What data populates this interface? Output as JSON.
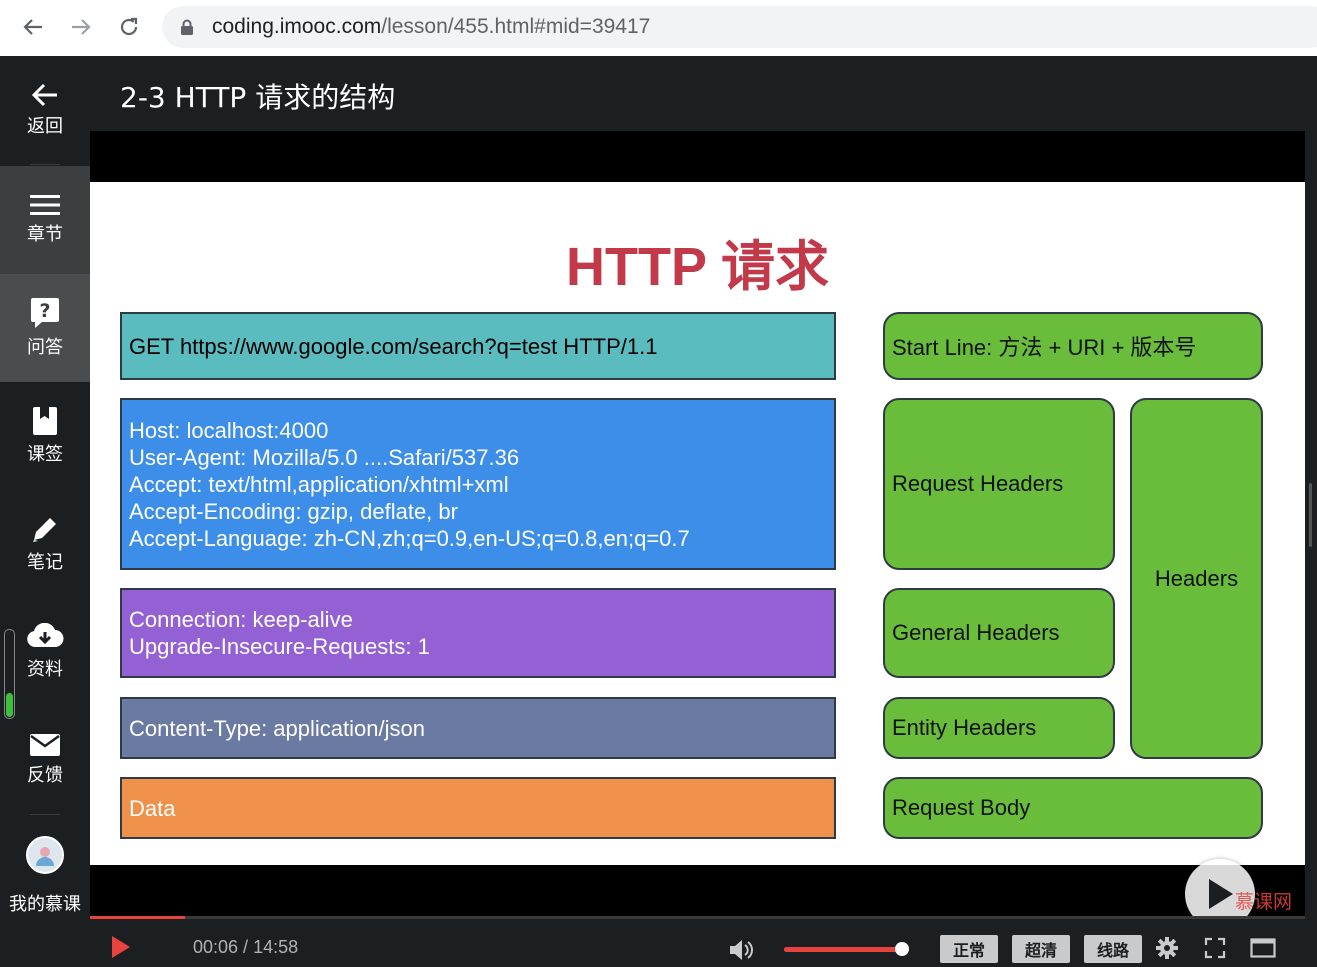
{
  "browser": {
    "url_host": "coding.imooc.com",
    "url_path": "/lesson/455.html#mid=39417"
  },
  "sidebar": {
    "items": [
      {
        "label": "返回",
        "icon": "back-arrow-icon"
      },
      {
        "label": "章节",
        "icon": "menu-icon"
      },
      {
        "label": "问答",
        "icon": "question-icon"
      },
      {
        "label": "课签",
        "icon": "bookmark-icon"
      },
      {
        "label": "笔记",
        "icon": "pencil-icon"
      },
      {
        "label": "资料",
        "icon": "cloud-download-icon"
      },
      {
        "label": "反馈",
        "icon": "mail-icon"
      }
    ],
    "my_mooc_label": "我的慕课",
    "progress_fraction": 0.28
  },
  "lesson": {
    "title": "2-3 HTTP 请求的结构"
  },
  "slide": {
    "title": "HTTP 请求",
    "request_line": "GET https://www.google.com/search?q=test HTTP/1.1",
    "request_headers": [
      "Host: localhost:4000",
      "User-Agent: Mozilla/5.0 ....Safari/537.36",
      "Accept: text/html,application/xhtml+xml",
      "Accept-Encoding: gzip, deflate, br",
      "Accept-Language: zh-CN,zh;q=0.9,en-US;q=0.8,en;q=0.7"
    ],
    "general_headers": [
      "Connection: keep-alive",
      "Upgrade-Insecure-Requests: 1"
    ],
    "entity_header": "Content-Type: application/json",
    "data": "Data",
    "labels": {
      "start_line": "Start Line: 方法 + URI + 版本号",
      "request_headers": "Request Headers",
      "general_headers": "General Headers",
      "entity_headers": "Entity Headers",
      "headers": "Headers",
      "request_body": "Request Body"
    },
    "colors": {
      "title": "#c23a49",
      "teal": "#5bbcbf",
      "blue": "#3d8ee8",
      "purple": "#9461d4",
      "slate": "#6b7aa3",
      "orange": "#ef914a",
      "green": "#69bd3b"
    },
    "watermark_text": "慕课网"
  },
  "player": {
    "current_time": "00:06",
    "separator": " / ",
    "duration": "14:58",
    "played_fraction": 0.078,
    "volume_fraction": 0.98,
    "quality_buttons": [
      "正常",
      "超清",
      "线路"
    ],
    "accent": "#e8433e"
  }
}
